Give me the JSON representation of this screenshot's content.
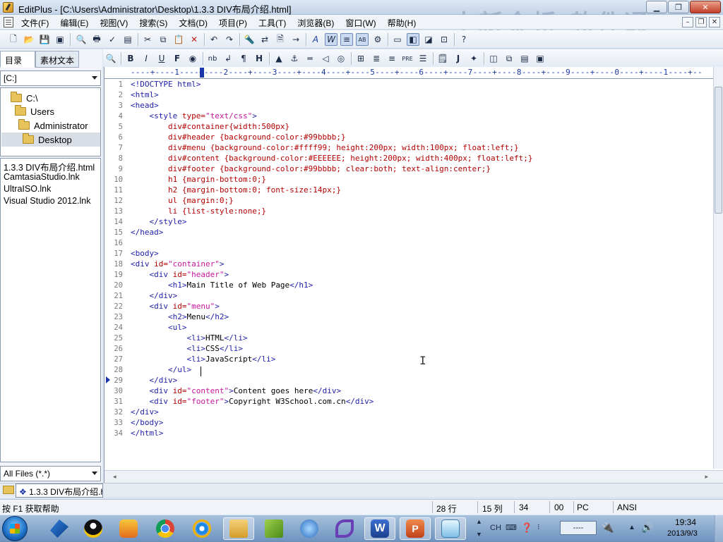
{
  "window": {
    "title": "EditPlus - [C:\\Users\\Administrator\\Desktop\\1.3.3 DIV布局介绍.html]",
    "watermark": "中新金桥  软件通"
  },
  "menu": [
    "文件(F)",
    "编辑(E)",
    "视图(V)",
    "搜索(S)",
    "文档(D)",
    "项目(P)",
    "工具(T)",
    "浏览器(B)",
    "窗口(W)",
    "帮助(H)"
  ],
  "left_panel": {
    "tabs": [
      "目录",
      "素材文本"
    ],
    "drive": "[C:]",
    "folders": [
      "C:\\",
      "Users",
      "Administrator",
      "Desktop"
    ],
    "files": [
      "1.3.3 DIV布局介绍.html",
      "CamtasiaStudio.lnk",
      "UltraISO.lnk",
      "Visual Studio 2012.lnk"
    ],
    "filter": "All Files (*.*)"
  },
  "editor": {
    "ruler": "----+----1----+----2----+----3----+----4----+----5----+----6----+----7----+----8----+----9----+----0----+----1----+--",
    "lines": [
      [
        [
          "t",
          "<!DOCTYPE html>"
        ]
      ],
      [
        [
          "t",
          "<html>"
        ]
      ],
      [
        [
          "t",
          "<head>"
        ]
      ],
      [
        [
          "x",
          "    "
        ],
        [
          "t",
          "<style "
        ],
        [
          "a",
          "type="
        ],
        [
          "v",
          "\"text/css\""
        ],
        [
          "t",
          ">"
        ]
      ],
      [
        [
          "x",
          "        "
        ],
        [
          "a",
          "div#container{width:500px}"
        ]
      ],
      [
        [
          "x",
          "        "
        ],
        [
          "a",
          "div#header {background-color:#99bbbb;}"
        ]
      ],
      [
        [
          "x",
          "        "
        ],
        [
          "a",
          "div#menu {background-color:#ffff99; height:200px; width:100px; float:left;}"
        ]
      ],
      [
        [
          "x",
          "        "
        ],
        [
          "a",
          "div#content {background-color:#EEEEEE; height:200px; width:400px; float:left;}"
        ]
      ],
      [
        [
          "x",
          "        "
        ],
        [
          "a",
          "div#footer {background-color:#99bbbb; clear:both; text-align:center;}"
        ]
      ],
      [
        [
          "x",
          "        "
        ],
        [
          "a",
          "h1 {margin-bottom:0;}"
        ]
      ],
      [
        [
          "x",
          "        "
        ],
        [
          "a",
          "h2 {margin-bottom:0; font-size:14px;}"
        ]
      ],
      [
        [
          "x",
          "        "
        ],
        [
          "a",
          "ul {margin:0;}"
        ]
      ],
      [
        [
          "x",
          "        "
        ],
        [
          "a",
          "li {list-style:none;}"
        ]
      ],
      [
        [
          "x",
          "    "
        ],
        [
          "t",
          "</style>"
        ]
      ],
      [
        [
          "t",
          "</head>"
        ]
      ],
      [
        [
          "x",
          ""
        ]
      ],
      [
        [
          "t",
          "<body>"
        ]
      ],
      [
        [
          "t",
          "<div "
        ],
        [
          "a",
          "id="
        ],
        [
          "v",
          "\"container\""
        ],
        [
          "t",
          ">"
        ]
      ],
      [
        [
          "x",
          "    "
        ],
        [
          "t",
          "<div "
        ],
        [
          "a",
          "id="
        ],
        [
          "v",
          "\"header\""
        ],
        [
          "t",
          ">"
        ]
      ],
      [
        [
          "x",
          "        "
        ],
        [
          "t",
          "<h1>"
        ],
        [
          "x",
          "Main Title of Web Page"
        ],
        [
          "t",
          "</h1>"
        ]
      ],
      [
        [
          "x",
          "    "
        ],
        [
          "t",
          "</div>"
        ]
      ],
      [
        [
          "x",
          "    "
        ],
        [
          "t",
          "<div "
        ],
        [
          "a",
          "id="
        ],
        [
          "v",
          "\"menu\""
        ],
        [
          "t",
          ">"
        ]
      ],
      [
        [
          "x",
          "        "
        ],
        [
          "t",
          "<h2>"
        ],
        [
          "x",
          "Menu"
        ],
        [
          "t",
          "</h2>"
        ]
      ],
      [
        [
          "x",
          "        "
        ],
        [
          "t",
          "<ul>"
        ]
      ],
      [
        [
          "x",
          "            "
        ],
        [
          "t",
          "<li>"
        ],
        [
          "x",
          "HTML"
        ],
        [
          "t",
          "</li>"
        ]
      ],
      [
        [
          "x",
          "            "
        ],
        [
          "t",
          "<li>"
        ],
        [
          "x",
          "CSS"
        ],
        [
          "t",
          "</li>"
        ]
      ],
      [
        [
          "x",
          "            "
        ],
        [
          "t",
          "<li>"
        ],
        [
          "x",
          "JavaScript"
        ],
        [
          "t",
          "</li>"
        ]
      ],
      [
        [
          "x",
          "        "
        ],
        [
          "t",
          "</ul>"
        ]
      ],
      [
        [
          "x",
          "    "
        ],
        [
          "t",
          "</div>"
        ]
      ],
      [
        [
          "x",
          "    "
        ],
        [
          "t",
          "<div "
        ],
        [
          "a",
          "id="
        ],
        [
          "v",
          "\"content\""
        ],
        [
          "t",
          ">"
        ],
        [
          "x",
          "Content goes here"
        ],
        [
          "t",
          "</div>"
        ]
      ],
      [
        [
          "x",
          "    "
        ],
        [
          "t",
          "<div "
        ],
        [
          "a",
          "id="
        ],
        [
          "v",
          "\"footer\""
        ],
        [
          "t",
          ">"
        ],
        [
          "x",
          "Copyright W3School.com.cn"
        ],
        [
          "t",
          "</div>"
        ]
      ],
      [
        [
          "t",
          "</div>"
        ]
      ],
      [
        [
          "t",
          "</body>"
        ]
      ],
      [
        [
          "t",
          "</html>"
        ]
      ]
    ],
    "current_line": 28
  },
  "doc_tabs": [
    "1.3.3 DIV布局介绍.h"
  ],
  "status": {
    "help": "按 F1 获取帮助",
    "line": "28 行",
    "col": "15 列",
    "total": "34",
    "mode": "00",
    "format": "PC",
    "encoding": "ANSI"
  },
  "taskbar": {
    "lang": "CH",
    "tray_box": "----",
    "time": "19:34",
    "date": "2013/9/3"
  }
}
